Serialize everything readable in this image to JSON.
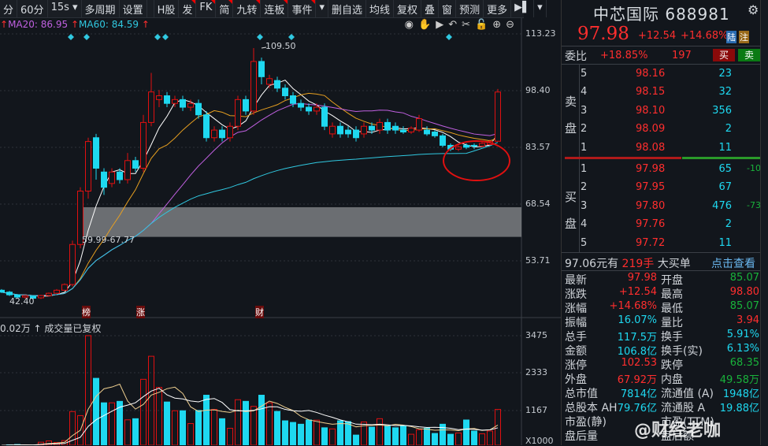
{
  "toolbar": {
    "items": [
      "分",
      "60分",
      "15s ▾",
      "多周期",
      "设置"
    ],
    "right_items": [
      "H股",
      "发",
      "FK",
      "简",
      "九转",
      "连板",
      "事件",
      "▾",
      "删自选",
      "均线",
      "复权",
      "叠",
      "窗",
      "预测",
      "更多",
      "▶▌",
      "▾"
    ]
  },
  "ma_legend": {
    "ma20": "MA20: 86.95",
    "ma60": "MA60: 84.59",
    "arrow": "↑"
  },
  "chart_tools": [
    "eye-icon",
    "hand-icon",
    "play-icon",
    "undo-icon",
    "scissors-icon",
    "lock-icon",
    "zoom-in-icon",
    "zoom-out-icon"
  ],
  "chart_tool_glyphs": [
    "◉",
    "✋",
    "▶",
    "↶",
    "✂",
    "🔓",
    "⊕",
    "⊖"
  ],
  "price_axis": [
    "113.23",
    "98.40",
    "83.57",
    "68.54",
    "53.71"
  ],
  "price_range": [
    53.71,
    113.23
  ],
  "volume_axis": [
    "3475",
    "2333",
    "1167",
    "X1000"
  ],
  "volume_header": "0.02万 ↑ 成交量已复权",
  "annotations": {
    "high": "109.50",
    "low": "42.40",
    "zone": "59.99-67.77",
    "zone_range": [
      59.99,
      67.77
    ],
    "tags": [
      "榜",
      "涨",
      "财"
    ]
  },
  "colors": {
    "up": "#e01010",
    "down": "#1ed8f0",
    "ma5": "#ffffff",
    "ma10": "#e8a020",
    "ma20": "#c060e0",
    "ma60": "#30c8e0"
  },
  "candles": [
    [
      46,
      46.3,
      45.3,
      45.5
    ],
    [
      45.5,
      45.8,
      44.5,
      44.8
    ],
    [
      44.8,
      45,
      44,
      44.2
    ],
    [
      44.2,
      44.8,
      43.8,
      44.6
    ],
    [
      44.4,
      44.6,
      43.6,
      43.9
    ],
    [
      44,
      44.8,
      43.7,
      44.6
    ],
    [
      44.6,
      45.4,
      44.3,
      45.2
    ],
    [
      45.2,
      46.3,
      45,
      46
    ],
    [
      46,
      47.8,
      45.8,
      47.5
    ],
    [
      47.5,
      59,
      47,
      58
    ],
    [
      58,
      73,
      57,
      72
    ],
    [
      72,
      86,
      70,
      85
    ],
    [
      86,
      87,
      75,
      78
    ],
    [
      77,
      78,
      71,
      73
    ],
    [
      74,
      78,
      73,
      77
    ],
    [
      77,
      78,
      74,
      75
    ],
    [
      75,
      82,
      74,
      80
    ],
    [
      80,
      81,
      77,
      78
    ],
    [
      78,
      92,
      77,
      90
    ],
    [
      90,
      103,
      89,
      98
    ],
    [
      96,
      98.5,
      94,
      97
    ],
    [
      97,
      98,
      94,
      95
    ],
    [
      95,
      97,
      94,
      96
    ],
    [
      96,
      97,
      93,
      94
    ],
    [
      94,
      96,
      93,
      95
    ],
    [
      95,
      96,
      91,
      92
    ],
    [
      92,
      93,
      85,
      86
    ],
    [
      86,
      89,
      85,
      88
    ],
    [
      88,
      89,
      85,
      86
    ],
    [
      86,
      90,
      85,
      89
    ],
    [
      89,
      97,
      88,
      96
    ],
    [
      96,
      97,
      92,
      93
    ],
    [
      93,
      109.5,
      92,
      106
    ],
    [
      106,
      107,
      100,
      102
    ],
    [
      100,
      102.5,
      99,
      101.5
    ],
    [
      101,
      102,
      98,
      99
    ],
    [
      99,
      100,
      96,
      97
    ],
    [
      97,
      98,
      94,
      95
    ],
    [
      95,
      96,
      93,
      94
    ],
    [
      94,
      95,
      92,
      93
    ],
    [
      93,
      95,
      92,
      94
    ],
    [
      94,
      95,
      88,
      89
    ],
    [
      87,
      90,
      86,
      89
    ],
    [
      89,
      90,
      86,
      87
    ],
    [
      88,
      89,
      86,
      87
    ],
    [
      88,
      89,
      85,
      86
    ],
    [
      87,
      90,
      86,
      89
    ],
    [
      89,
      90,
      87,
      88
    ],
    [
      88,
      91,
      87,
      90
    ],
    [
      90,
      91,
      87,
      88
    ],
    [
      89,
      90,
      87,
      88
    ],
    [
      88,
      89,
      87,
      87.5
    ],
    [
      87.5,
      89,
      87,
      88.5
    ],
    [
      88,
      92,
      87.5,
      91
    ],
    [
      88,
      89,
      86.5,
      87
    ],
    [
      87.5,
      88,
      86,
      86.5
    ],
    [
      86.5,
      87,
      83.5,
      84
    ],
    [
      84,
      84.5,
      82.5,
      83
    ],
    [
      83,
      84,
      82.5,
      83.6
    ],
    [
      84,
      84.5,
      83,
      83.5
    ],
    [
      84,
      84.5,
      83,
      83.8
    ],
    [
      83.8,
      85,
      83.5,
      84.5
    ],
    [
      84.2,
      85.5,
      84,
      85
    ],
    [
      85.07,
      98.8,
      85.07,
      97.98
    ]
  ],
  "volumes": [
    90,
    110,
    120,
    100,
    100,
    190,
    230,
    180,
    240,
    1135,
    1010,
    3476,
    2160,
    1405,
    1405,
    1450,
    880,
    915,
    2130,
    2840,
    1880,
    1430,
    1160,
    1160,
    765,
    1170,
    1640,
    1200,
    915,
    620,
    1500,
    1450,
    1295,
    1640,
    1405,
    1140,
    850,
    800,
    745,
    875,
    870,
    635,
    600,
    850,
    825,
    410,
    815,
    655,
    915,
    680,
    635,
    700,
    435,
    575,
    620,
    460,
    745,
    435,
    475,
    875,
    535,
    450,
    535,
    1200
  ],
  "quote": {
    "name": "中芯国际",
    "code": "688981",
    "price": "97.98",
    "change": "+12.54",
    "pct": "+14.68%",
    "badge1": "陆",
    "badge2": "注",
    "weibi_label": "委比",
    "weibi": "+18.85%",
    "weicha": "197",
    "buy_btn": "买",
    "sell_btn": "卖",
    "sell_label": "卖盘",
    "buy_label": "买盘",
    "asks": [
      {
        "lvl": "5",
        "p": "98.16",
        "v": "23"
      },
      {
        "lvl": "4",
        "p": "98.15",
        "v": "32"
      },
      {
        "lvl": "3",
        "p": "98.10",
        "v": "356"
      },
      {
        "lvl": "2",
        "p": "98.09",
        "v": "2"
      },
      {
        "lvl": "1",
        "p": "98.08",
        "v": "11"
      }
    ],
    "bids": [
      {
        "lvl": "1",
        "p": "97.98",
        "v": "65",
        "d": "-10"
      },
      {
        "lvl": "2",
        "p": "97.95",
        "v": "67",
        "d": ""
      },
      {
        "lvl": "3",
        "p": "97.80",
        "v": "476",
        "d": "-73"
      },
      {
        "lvl": "4",
        "p": "97.76",
        "v": "2",
        "d": ""
      },
      {
        "lvl": "5",
        "p": "97.72",
        "v": "11",
        "d": ""
      }
    ],
    "big_order": {
      "price": "97.06元有",
      "qty": "219手",
      "text": "大买单",
      "link": "点击查看"
    },
    "stats": [
      {
        "l1": "最新",
        "v1": "97.98",
        "c1": "red",
        "l2": "开盘",
        "v2": "85.07",
        "c2": "green"
      },
      {
        "l1": "涨跌",
        "v1": "+12.54",
        "c1": "red",
        "l2": "最高",
        "v2": "98.80",
        "c2": "red"
      },
      {
        "l1": "涨幅",
        "v1": "+14.68%",
        "c1": "red",
        "l2": "最低",
        "v2": "85.07",
        "c2": "green"
      },
      {
        "l1": "振幅",
        "v1": "16.07%",
        "c1": "cyan",
        "l2": "量比",
        "v2": "3.94",
        "c2": "red"
      },
      {
        "l1": "总手",
        "v1": "117.5万",
        "c1": "cyan",
        "l2": "换手",
        "v2": "5.91%",
        "c2": "cyan"
      },
      {
        "l1": "金额",
        "v1": "106.8亿",
        "c1": "cyan",
        "l2": "换手(实)",
        "v2": "6.13%",
        "c2": "cyan"
      },
      {
        "l1": "涨停",
        "v1": "102.53",
        "c1": "red",
        "l2": "跌停",
        "v2": "68.35",
        "c2": "green"
      },
      {
        "l1": "外盘",
        "v1": "67.92万",
        "c1": "red",
        "l2": "内盘",
        "v2": "49.58万",
        "c2": "green"
      },
      {
        "l1": "总市值",
        "v1": "7814亿",
        "c1": "cyan",
        "l2": "流通值 (A)",
        "v2": "1948亿",
        "c2": "cyan"
      },
      {
        "l1": "总股本 AH",
        "v1": "79.76亿",
        "c1": "cyan",
        "l2": "流通股 A",
        "v2": "19.88亿",
        "c2": "cyan"
      },
      {
        "l1": "市盈(静)",
        "v1": "",
        "c1": "grey",
        "l2": "市盈(TTM)",
        "v2": "",
        "c2": "grey"
      },
      {
        "l1": "盘后量",
        "v1": "",
        "c1": "grey",
        "l2": "盘后额",
        "v2": "",
        "c2": "grey"
      }
    ]
  },
  "watermark": "@财经老咖"
}
